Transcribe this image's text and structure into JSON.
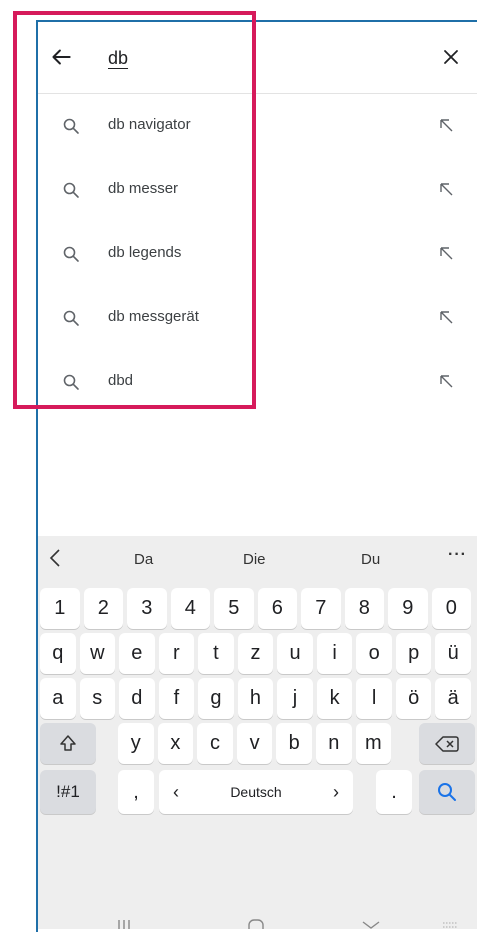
{
  "search": {
    "query": "db"
  },
  "suggestions": [
    {
      "text": "db navigator"
    },
    {
      "text": "db messer"
    },
    {
      "text": "db legends"
    },
    {
      "text": "db messgerät"
    },
    {
      "text": "dbd"
    }
  ],
  "keyboard": {
    "predictions": [
      "Da",
      "Die",
      "Du"
    ],
    "more": "···",
    "row_numbers": [
      "1",
      "2",
      "3",
      "4",
      "5",
      "6",
      "7",
      "8",
      "9",
      "0"
    ],
    "row_1": [
      "q",
      "w",
      "e",
      "r",
      "t",
      "z",
      "u",
      "i",
      "o",
      "p",
      "ü"
    ],
    "row_2": [
      "a",
      "s",
      "d",
      "f",
      "g",
      "h",
      "j",
      "k",
      "l",
      "ö",
      "ä"
    ],
    "row_3": [
      "y",
      "x",
      "c",
      "v",
      "b",
      "n",
      "m"
    ],
    "symbols_label": "!#1",
    "comma": ",",
    "space_label": "Deutsch",
    "space_left": "‹",
    "space_right": "›",
    "period": "."
  },
  "colors": {
    "highlight": "#d61a5b",
    "frame": "#1f6fa8",
    "search_key": "#1a73e8"
  }
}
